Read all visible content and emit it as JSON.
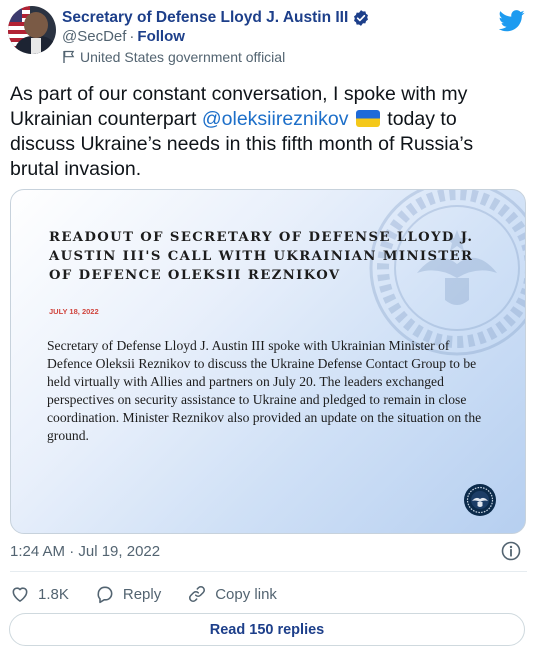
{
  "author": {
    "display_name": "Secretary of Defense Lloyd J. Austin III",
    "handle": "@SecDef",
    "separator": "·",
    "follow_label": "Follow",
    "account_label": "United States government official"
  },
  "tweet": {
    "text_before": "As part of our constant conversation, I spoke with my Ukrainian counterpart ",
    "mention": "@oleksiireznikov",
    "text_after": " today to discuss Ukraine’s needs in this fifth month of Russia’s brutal invasion."
  },
  "card": {
    "title": "READOUT OF SECRETARY OF DEFENSE LLOYD J. AUSTIN III'S CALL WITH UKRAINIAN MINISTER OF DEFENCE OLEKSII REZNIKOV",
    "date": "JULY 18, 2022",
    "body": "Secretary of Defense Lloyd J. Austin III spoke with Ukrainian Minister of Defence Oleksii Reznikov to discuss the Ukraine Defense Contact Group to be held virtually with Allies and partners on July 20. The leaders exchanged perspectives on security assistance to Ukraine and pledged to remain in close coordination. Minister Reznikov also provided an update on the situation on the ground."
  },
  "timestamp": "1:24 AM · Jul 19, 2022",
  "actions": {
    "like_count": "1.8K",
    "reply_label": "Reply",
    "copy_label": "Copy link"
  },
  "read_replies_label": "Read 150 replies",
  "icons": {
    "bird": "twitter-bird-icon",
    "verified": "verified-badge-icon",
    "flag": "government-flag-icon",
    "info": "info-icon",
    "like": "heart-icon",
    "reply": "reply-bubble-icon",
    "copy": "link-icon"
  },
  "colors": {
    "brand_blue": "#1d9bf0",
    "name_blue": "#1d3f8a",
    "mention_blue": "#1d6fc9",
    "muted_gray": "#536471",
    "date_red": "#d0453e"
  }
}
